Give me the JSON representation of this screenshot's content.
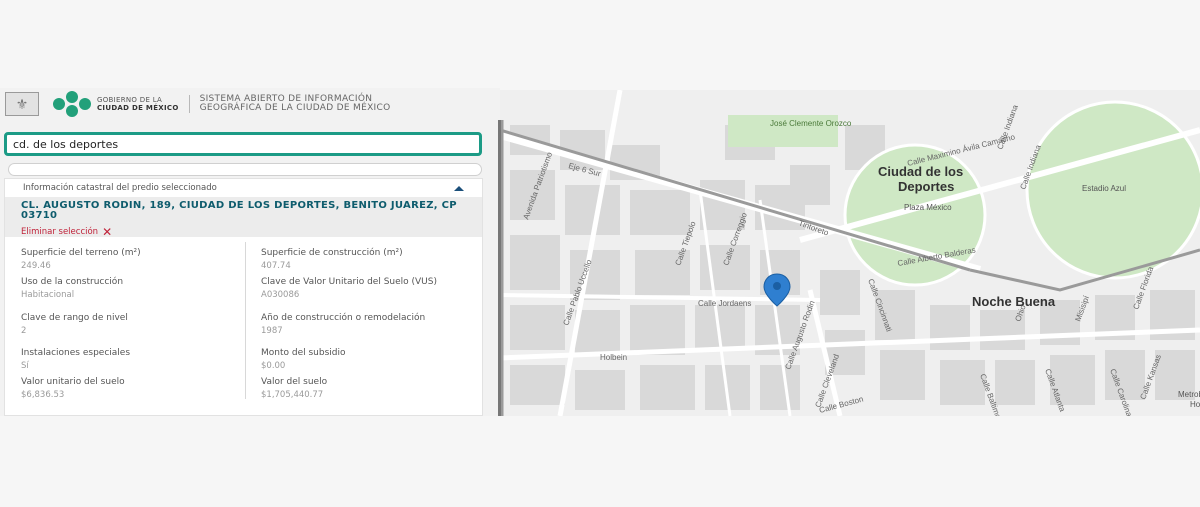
{
  "header": {
    "gov_line1": "GOBIERNO DE LA",
    "gov_line2": "CIUDAD DE MÉXICO",
    "system_line1": "SISTEMA ABIERTO DE INFORMACIÓN",
    "system_line2": "GEOGRÁFICA DE LA CIUDAD DE MÉXICO"
  },
  "search": {
    "value": "cd. de los deportes"
  },
  "info": {
    "title": "Información catastral del predio seleccionado",
    "address": "CL. AUGUSTO RODIN, 189, CIUDAD DE LOS DEPORTES, BENITO JUAREZ, CP 03710",
    "remove_label": "Eliminar selección",
    "fields": [
      {
        "label": "Superficie del terreno (m²)",
        "value": "249.46"
      },
      {
        "label": "Superficie de construcción (m²)",
        "value": "407.74"
      },
      {
        "label": "Uso de la construcción",
        "value": "Habitacional"
      },
      {
        "label": "Clave de Valor Unitario del Suelo (VUS)",
        "value": "A030086"
      },
      {
        "label": "Clave de rango de nivel",
        "value": "2"
      },
      {
        "label": "Año de construcción o remodelación",
        "value": "1987"
      },
      {
        "label": "Instalaciones especiales",
        "value": "Sí"
      },
      {
        "label": "Monto del subsidio",
        "value": "$0.00"
      },
      {
        "label": "Valor unitario del suelo",
        "value": "$6,836.53"
      },
      {
        "label": "Valor del suelo",
        "value": "$1,705,440.77"
      }
    ]
  },
  "map": {
    "labels": {
      "park": "José Clemente Orozco",
      "neighborhood1_line1": "Ciudad de los",
      "neighborhood1_line2": "Deportes",
      "stadium1": "Plaza México",
      "stadium2": "Estadio Azul",
      "neighborhood2": "Noche Buena",
      "metro_1": "Metrobú",
      "metro_2": "Ho",
      "street_maximino": "Calle Maximino Ávila Camacho",
      "street_baldera": "Calle Alberto Balderas",
      "street_jordaens": "Calle Jordaens",
      "street_rodin": "Calle Augusto Rodin",
      "street_tintoretto": "Tintoreto",
      "street_holbein": "Holbein",
      "street_boston": "Calle Boston",
      "street_patriotismo": "Avenida Patriotismo",
      "street_6sur": "Eje 6 Sur",
      "street_indiana": "Calle Indiana",
      "street_cincinnati": "Calle Cincinnati",
      "street_cleveland": "Calle Cleveland",
      "street_correggio": "Calle Correggio",
      "street_tiepolo": "Calle Tiepolo",
      "street_uccello": "Calle Pablo Uccello",
      "street_florida": "Calle Florida",
      "street_carolina": "Calle Carolina",
      "street_atlanta": "Calle Atlanta",
      "street_baltimore": "Calle Baltimore",
      "street_kansas": "Calle Kansas",
      "street_mis": "Misisipí",
      "street_ohio": "Ohio",
      "street_ind2": "Calle Indiana"
    },
    "colors": {
      "park": "#cfe8c5",
      "road": "#ffffff",
      "rail": "#9a9a9a",
      "block": "#d9d9d9",
      "pin": "#2f7fd0"
    }
  }
}
